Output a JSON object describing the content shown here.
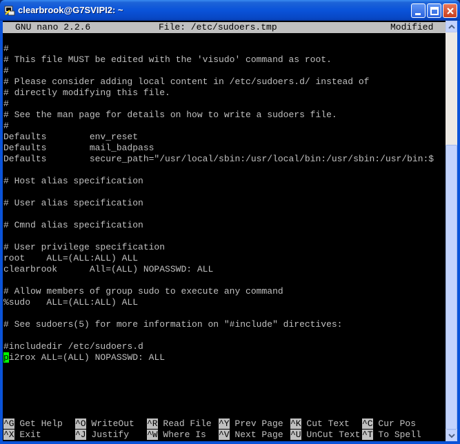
{
  "window": {
    "title": "clearbrook@G7SVIPI2: ~"
  },
  "nano": {
    "version": "GNU nano 2.2.6",
    "file": "File: /etc/sudoers.tmp",
    "status": "Modified"
  },
  "content": {
    "lines": [
      "#",
      "# This file MUST be edited with the 'visudo' command as root.",
      "#",
      "# Please consider adding local content in /etc/sudoers.d/ instead of",
      "# directly modifying this file.",
      "#",
      "# See the man page for details on how to write a sudoers file.",
      "#",
      "Defaults        env_reset",
      "Defaults        mail_badpass",
      "Defaults        secure_path=\"/usr/local/sbin:/usr/local/bin:/usr/sbin:/usr/bin:$",
      "",
      "# Host alias specification",
      "",
      "# User alias specification",
      "",
      "# Cmnd alias specification",
      "",
      "# User privilege specification",
      "root    ALL=(ALL:ALL) ALL",
      "clearbrook      All=(ALL) NOPASSWD: ALL",
      "",
      "# Allow members of group sudo to execute any command",
      "%sudo   ALL=(ALL:ALL) ALL",
      "",
      "# See sudoers(5) for more information on \"#include\" directives:",
      "",
      "#includedir /etc/sudoers.d"
    ],
    "cursor_char": "p",
    "cursor_line_rest": "i2rox ALL=(ALL) NOPASSWD: ALL"
  },
  "shortcuts": {
    "row1": [
      {
        "key": "^G",
        "label": " Get Help"
      },
      {
        "key": "^O",
        "label": " WriteOut"
      },
      {
        "key": "^R",
        "label": " Read File"
      },
      {
        "key": "^Y",
        "label": " Prev Page"
      },
      {
        "key": "^K",
        "label": " Cut Text"
      },
      {
        "key": "^C",
        "label": " Cur Pos"
      }
    ],
    "row2": [
      {
        "key": "^X",
        "label": " Exit"
      },
      {
        "key": "^J",
        "label": " Justify"
      },
      {
        "key": "^W",
        "label": " Where Is"
      },
      {
        "key": "^V",
        "label": " Next Page"
      },
      {
        "key": "^U",
        "label": " UnCut Text"
      },
      {
        "key": "^T",
        "label": " To Spell"
      }
    ]
  },
  "colors": {
    "terminal_bg": "#000000",
    "terminal_fg": "#c0c0c0",
    "cursor": "#00ff00",
    "titlebar": "#0a53d9"
  },
  "icons": {
    "window": "putty-icon",
    "minimize": "minimize-icon",
    "maximize": "maximize-icon",
    "close": "close-icon"
  }
}
